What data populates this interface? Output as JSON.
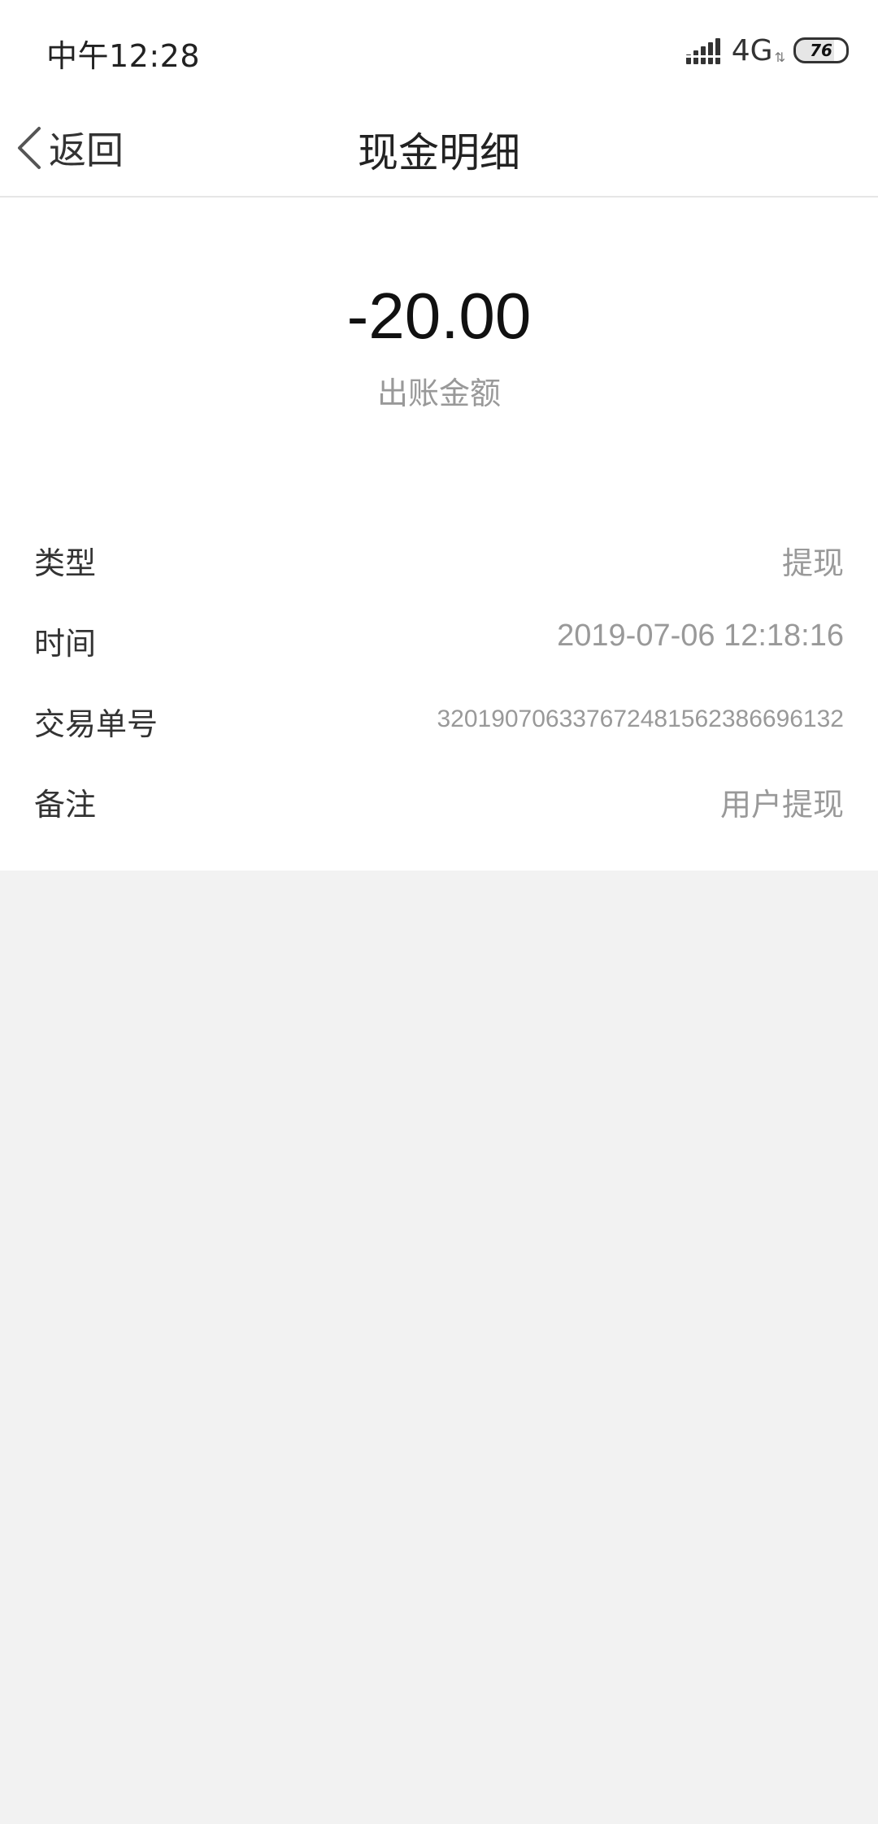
{
  "status_bar": {
    "time": "中午12:28",
    "network": "4G",
    "network_arrows": "⇅",
    "battery": "76",
    "signal_icon": "signal-icon",
    "battery_icon": "battery-icon"
  },
  "nav": {
    "back_label": "返回",
    "back_icon": "chevron-left-icon",
    "title": "现金明细"
  },
  "summary": {
    "amount": "-20.00",
    "amount_label": "出账金额"
  },
  "details": [
    {
      "label": "类型",
      "value": "提现"
    },
    {
      "label": "时间",
      "value": "2019-07-06 12:18:16"
    },
    {
      "label": "交易单号",
      "value": "320190706337672481562386696132"
    },
    {
      "label": "备注",
      "value": "用户提现"
    }
  ],
  "colors": {
    "background": "#f2f2f2",
    "card": "#ffffff",
    "primary_text": "#333333",
    "secondary_text": "#999999"
  }
}
